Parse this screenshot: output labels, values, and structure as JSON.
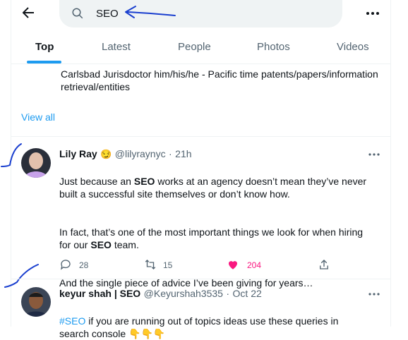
{
  "search": {
    "query": "SEO"
  },
  "tabs": [
    "Top",
    "Latest",
    "People",
    "Photos",
    "Videos"
  ],
  "previous_card": {
    "bio": "Carlsbad Jurisdoctor him/his/he - Pacific time patents/papers/information retrieval/entities",
    "view_all": "View all"
  },
  "tweet1": {
    "name": "Lily Ray",
    "emoji": "😏",
    "handle": "@lilyraynyc",
    "sep": "·",
    "time": "21h",
    "p1_a": "Just because an ",
    "p1_b": "SEO",
    "p1_c": " works at an agency doesn’t mean they’ve never built a successful site themselves or don’t know how.",
    "p2_a": "In fact, that’s one of the most important things we look for when hiring for our ",
    "p2_b": "SEO",
    "p2_c": " team.",
    "p3": "And the single piece of advice I’ve been giving for years…",
    "replies": "28",
    "retweets": "15",
    "likes": "204"
  },
  "tweet2": {
    "name_a": "keyur shah | ",
    "name_b": "SEO",
    "handle": "@Keyurshah3535",
    "sep": "·",
    "time": "Oct 22",
    "hashtag": "#SEO",
    "text": " if you are running out of topics ideas use these queries in search console ",
    "emoji": "👇👇👇"
  },
  "colors": {
    "accent": "#1d9bf0",
    "like": "#f91880",
    "annotation": "#1a3fcf"
  }
}
